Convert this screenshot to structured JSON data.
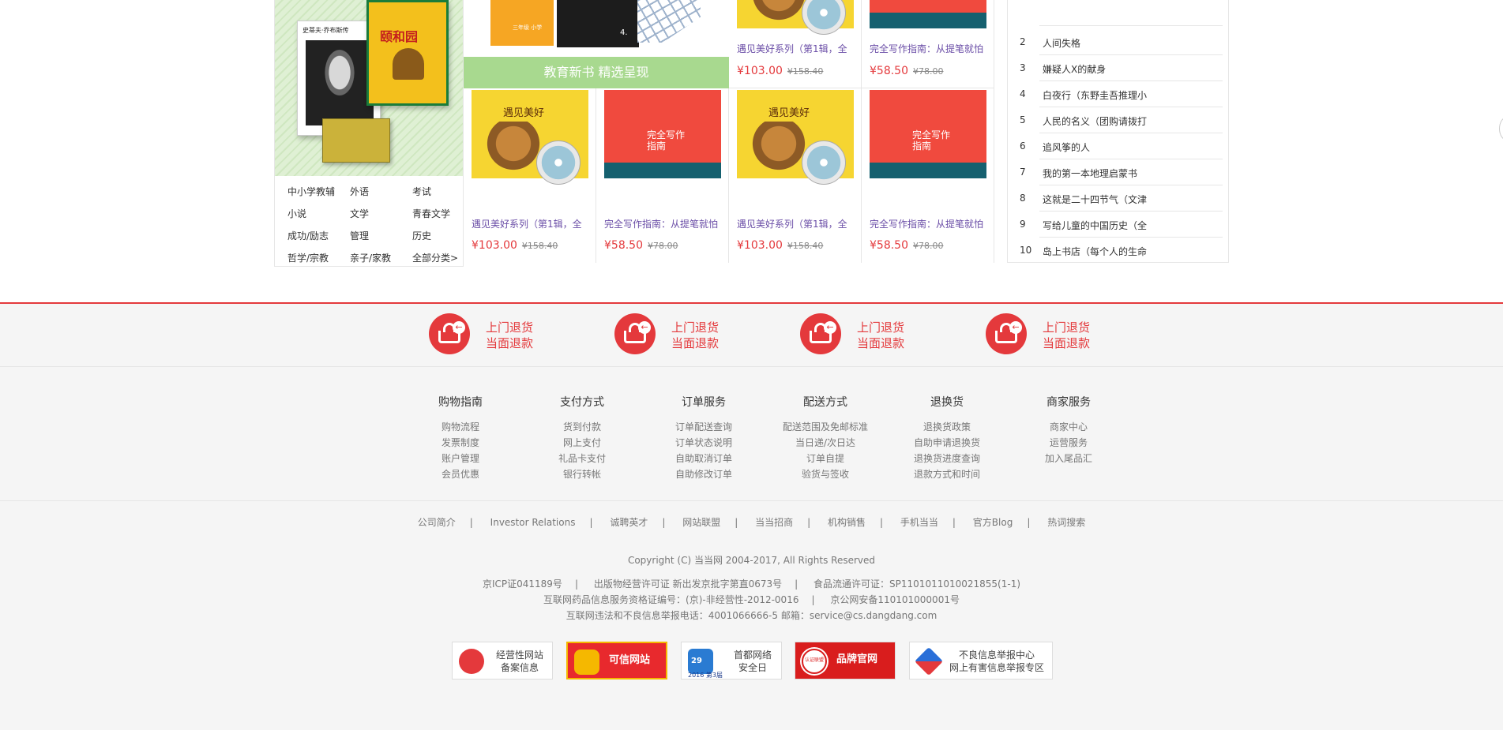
{
  "categories": [
    [
      "中小学教辅",
      "外语",
      "考试"
    ],
    [
      "小说",
      "文学",
      "青春文学"
    ],
    [
      "成功/励志",
      "管理",
      "历史"
    ],
    [
      "哲学/宗教",
      "亲子/家教",
      "全部分类>"
    ]
  ],
  "left_banner": {
    "jobs_title": "史蒂夫·乔布斯传",
    "yhy_title": "颐和园"
  },
  "mid_banner": {
    "strip_text": "教育新书 精选呈现",
    "book1_text": "三年级 小学",
    "book2_num": "4."
  },
  "top_products": [
    {
      "name": "遇见美好系列（第1辑，全",
      "price": "¥103.00",
      "old_price": "¥158.40"
    },
    {
      "name": "完全写作指南：从提笔就怕",
      "price": "¥58.50",
      "old_price": "¥78.00"
    }
  ],
  "bottom_products": [
    {
      "name": "遇见美好系列（第1辑，全",
      "price": "¥103.00",
      "old_price": "¥158.40",
      "cover_title": "遇见美好"
    },
    {
      "name": "完全写作指南：从提笔就怕",
      "price": "¥58.50",
      "old_price": "¥78.00",
      "cover_title": "完全写作指南"
    },
    {
      "name": "遇见美好系列（第1辑，全",
      "price": "¥103.00",
      "old_price": "¥158.40",
      "cover_title": "遇见美好"
    },
    {
      "name": "完全写作指南：从提笔就怕",
      "price": "¥58.50",
      "old_price": "¥78.00",
      "cover_title": "完全写作指南"
    }
  ],
  "ranking": [
    {
      "num": "2",
      "title": "人间失格"
    },
    {
      "num": "3",
      "title": "嫌疑人X的献身"
    },
    {
      "num": "4",
      "title": "白夜行（东野圭吾推理小"
    },
    {
      "num": "5",
      "title": "人民的名义（团购请拨打"
    },
    {
      "num": "6",
      "title": "追风筝的人"
    },
    {
      "num": "7",
      "title": "我的第一本地理启蒙书"
    },
    {
      "num": "8",
      "title": "这就是二十四节气（文津"
    },
    {
      "num": "9",
      "title": "写给儿童的中国历史（全"
    },
    {
      "num": "10",
      "title": "岛上书店（每个人的生命"
    }
  ],
  "services": [
    {
      "line1": "上门退货",
      "line2": "当面退款",
      "icon": "return-basket-icon"
    },
    {
      "line1": "上门退货",
      "line2": "当面退款",
      "icon": "return-basket-icon"
    },
    {
      "line1": "上门退货",
      "line2": "当面退款",
      "icon": "return-basket-icon"
    },
    {
      "line1": "上门退货",
      "line2": "当面退款",
      "icon": "return-basket-icon"
    }
  ],
  "help_columns": [
    {
      "title": "购物指南",
      "links": [
        "购物流程",
        "发票制度",
        "账户管理",
        "会员优惠"
      ]
    },
    {
      "title": "支付方式",
      "links": [
        "货到付款",
        "网上支付",
        "礼品卡支付",
        "银行转帐"
      ]
    },
    {
      "title": "订单服务",
      "links": [
        "订单配送查询",
        "订单状态说明",
        "自助取消订单",
        "自助修改订单"
      ]
    },
    {
      "title": "配送方式",
      "links": [
        "配送范围及免邮标准",
        "当日递/次日达",
        "订单自提",
        "验货与签收"
      ]
    },
    {
      "title": "退换货",
      "links": [
        "退换货政策",
        "自助申请退换货",
        "退换货进度查询",
        "退款方式和时间"
      ]
    },
    {
      "title": "商家服务",
      "links": [
        "商家中心",
        "运营服务",
        "加入尾品汇"
      ]
    }
  ],
  "footer_links": [
    "公司简介",
    "Investor Relations",
    "诚聘英才",
    "网站联盟",
    "当当招商",
    "机构销售",
    "手机当当",
    "官方Blog",
    "热词搜索"
  ],
  "copyright": "Copyright (C) 当当网 2004-2017, All Rights Reserved",
  "licenses": [
    [
      "京ICP证041189号",
      "出版物经营许可证 新出发京批字第直0673号",
      "食品流通许可证：SP1101011010021855(1-1)"
    ],
    [
      "互联网药品信息服务资格证编号：(京)-非经营性-2012-0016",
      "京公网安备110101000001号"
    ],
    [
      "互联网违法和不良信息举报电话：4001066666-5 邮箱：service@cs.dangdang.com"
    ]
  ],
  "badges": [
    {
      "line1": "经营性网站",
      "line2": "备案信息",
      "icon": "shield-emblem-icon"
    },
    {
      "line1": "可信网站",
      "line2": "",
      "icon": "trusted-site-icon"
    },
    {
      "line1": "首都网络",
      "line2": "安全日",
      "icon": "capital-security-icon",
      "sub": "2016 第3届",
      "num": "29"
    },
    {
      "line1": "品牌官网",
      "line2": "",
      "icon": "certified-brand-icon",
      "seal": "认证联盟"
    },
    {
      "line1": "不良信息举报中心",
      "line2": "网上有害信息举报专区",
      "icon": "report-center-icon"
    }
  ],
  "colors": {
    "accent": "#e4393c",
    "green": "#a8d98f",
    "link_purple": "#6b4ea7"
  }
}
